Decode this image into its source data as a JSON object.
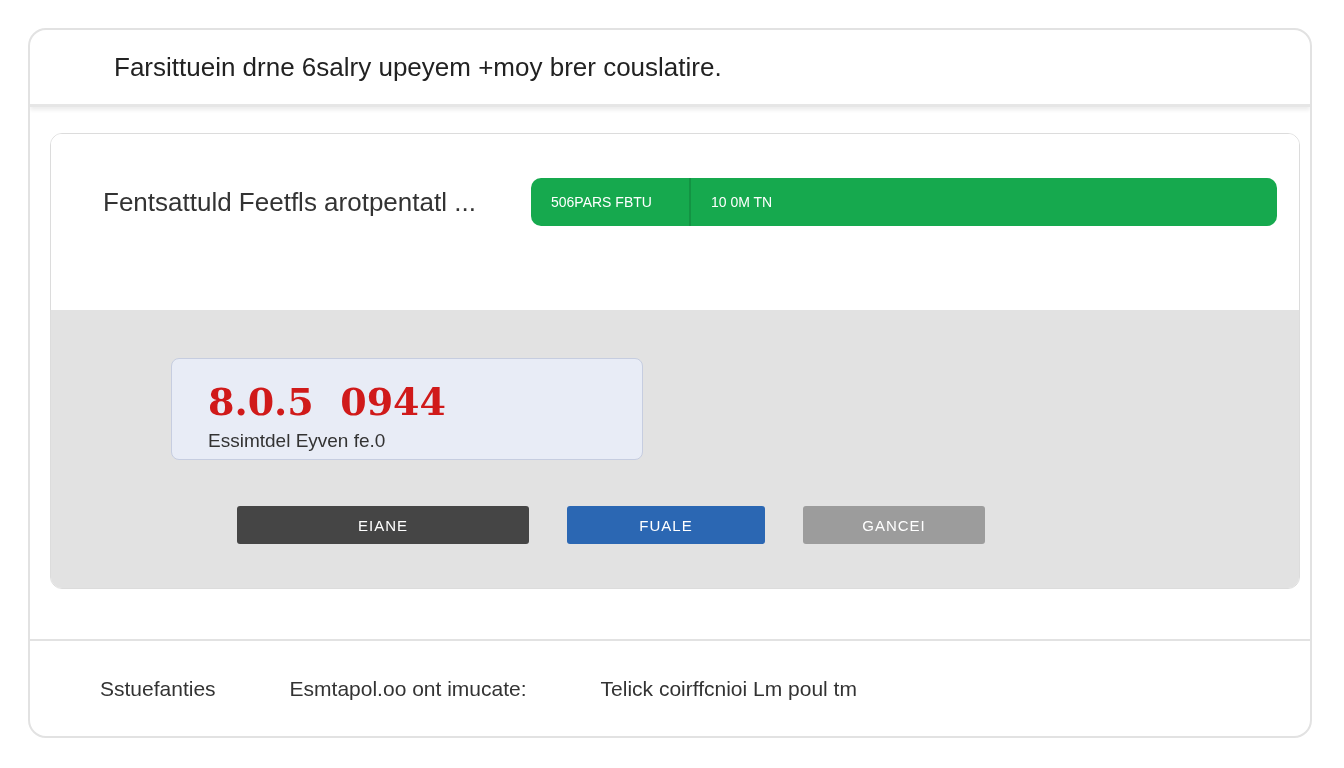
{
  "header": {
    "title": "Farsittuein drne 6salry upeyem +moy  brer couslatire."
  },
  "panel": {
    "label": "Fentsattuld Feetfls arotpentatl ...",
    "bar": [
      "506PARS FBTU",
      "10 0M TN"
    ]
  },
  "estimate": {
    "value": "8.0.5  0944",
    "caption": "Essimtdel Eyven fe.0"
  },
  "buttons": [
    {
      "label": "EIANE",
      "kind": "dark"
    },
    {
      "label": "FUALE",
      "kind": "primary"
    },
    {
      "label": "GANCEI",
      "kind": "muted"
    }
  ],
  "footer": [
    "Sstuefanties",
    "Esmtapol.oo ont imucate:",
    "Telick coirffcnioi Lm poul tm"
  ]
}
